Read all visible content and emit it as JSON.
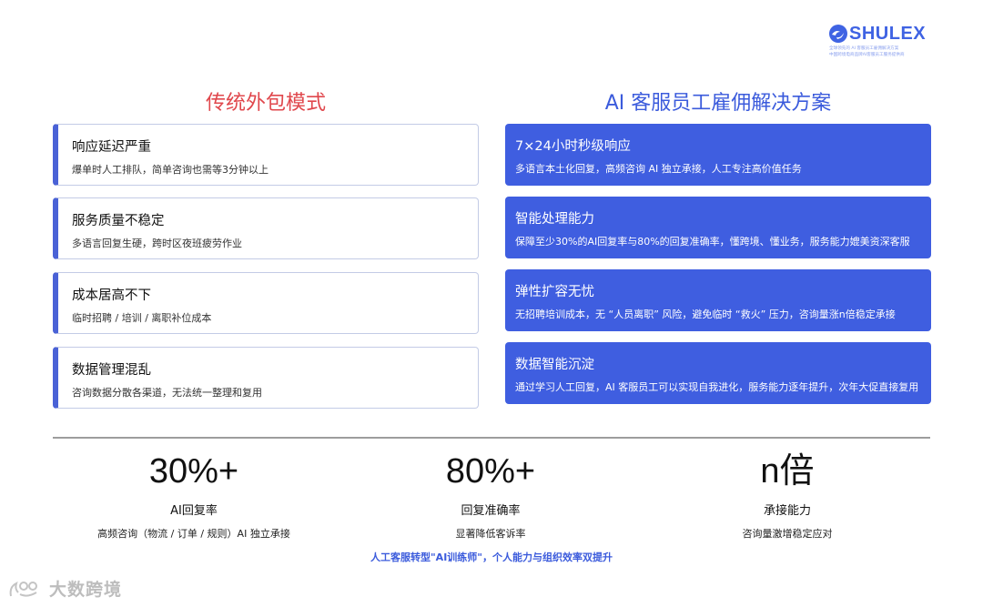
{
  "logo": {
    "name": "SHULEX",
    "tagline_1": "全球领先的 AI 客服员工雇佣解决方案",
    "tagline_2": "中国跨境电商品牌AI客服员工服务提供商",
    "brand_color": "#3f63e3"
  },
  "left_column": {
    "title": "传统外包模式",
    "accent": "#e0474c",
    "cards": [
      {
        "title": "响应延迟严重",
        "desc": "爆单时人工排队，简单咨询也需等3分钟以上"
      },
      {
        "title": "服务质量不稳定",
        "desc": "多语言回复生硬，跨时区夜班疲劳作业"
      },
      {
        "title": "成本居高不下",
        "desc": "临时招聘 / 培训 / 离职补位成本"
      },
      {
        "title": "数据管理混乱",
        "desc": "咨询数据分散各渠道，无法统一整理和复用"
      }
    ]
  },
  "right_column": {
    "title": "AI 客服员工雇佣解决方案",
    "accent": "#3f5ee0",
    "cards": [
      {
        "title": "7×24小时秒级响应",
        "desc": "多语言本土化回复，高频咨询 AI 独立承接，人工专注高价值任务"
      },
      {
        "title": "智能处理能力",
        "desc": "保障至少30%的AI回复率与80%的回复准确率，懂跨境、懂业务，服务能力媲美资深客服"
      },
      {
        "title": "弹性扩容无忧",
        "desc": "无招聘培训成本，无 “人员离职” 风险，避免临时 “救火” 压力，咨询量涨n倍稳定承接"
      },
      {
        "title": "数据智能沉淀",
        "desc": "通过学习人工回复，AI 客服员工可以实现自我进化，服务能力逐年提升，次年大促直接复用"
      }
    ]
  },
  "stats": [
    {
      "value": "30%+",
      "label": "AI回复率",
      "sub": "高频咨询（物流 / 订单 / 规则）AI 独立承接"
    },
    {
      "value": "80%+",
      "label": "回复准确率",
      "sub": "显著降低客诉率"
    },
    {
      "value": "n倍",
      "label": "承接能力",
      "sub": "咨询量激增稳定应对"
    }
  ],
  "footer": "人工客服转型\"AI训练师\"，个人能力与组织效率双提升",
  "watermark": "大数跨境"
}
